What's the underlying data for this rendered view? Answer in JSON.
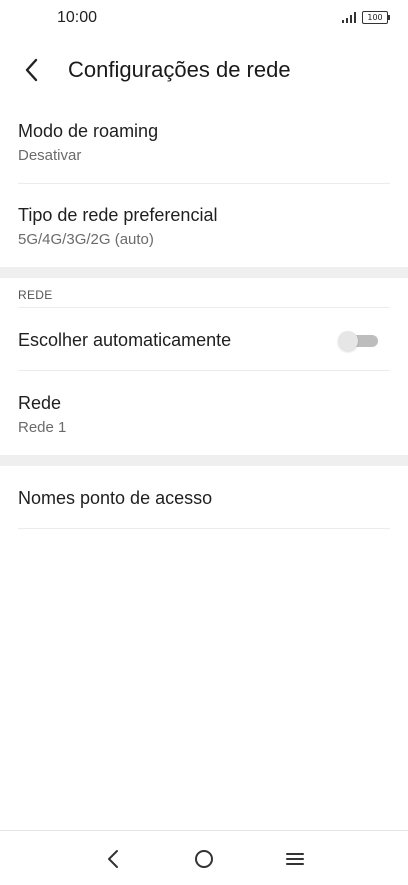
{
  "status_bar": {
    "time": "10:00",
    "battery": "100",
    "icons": [
      "signal-icon",
      "battery-icon"
    ]
  },
  "header": {
    "title": "Configurações de rede",
    "back_icon": "chevron-left-icon"
  },
  "items": {
    "roaming": {
      "title": "Modo de roaming",
      "value": "Desativar"
    },
    "network_type": {
      "title": "Tipo de rede preferencial",
      "value": "5G/4G/3G/2G (auto)"
    }
  },
  "section_rede": {
    "header": "REDE",
    "auto_select": {
      "title": "Escolher automaticamente",
      "toggle_on": false
    },
    "network": {
      "title": "Rede",
      "value": "Rede 1"
    }
  },
  "apn": {
    "title": "Nomes ponto de acesso"
  },
  "nav": {
    "icons": [
      "back-nav-icon",
      "home-nav-icon",
      "menu-nav-icon"
    ]
  },
  "colors": {
    "background": "#ffffff",
    "section_gap": "#efefef",
    "toggle_track": "#bdbdbd",
    "toggle_thumb": "#e6e6e6"
  }
}
